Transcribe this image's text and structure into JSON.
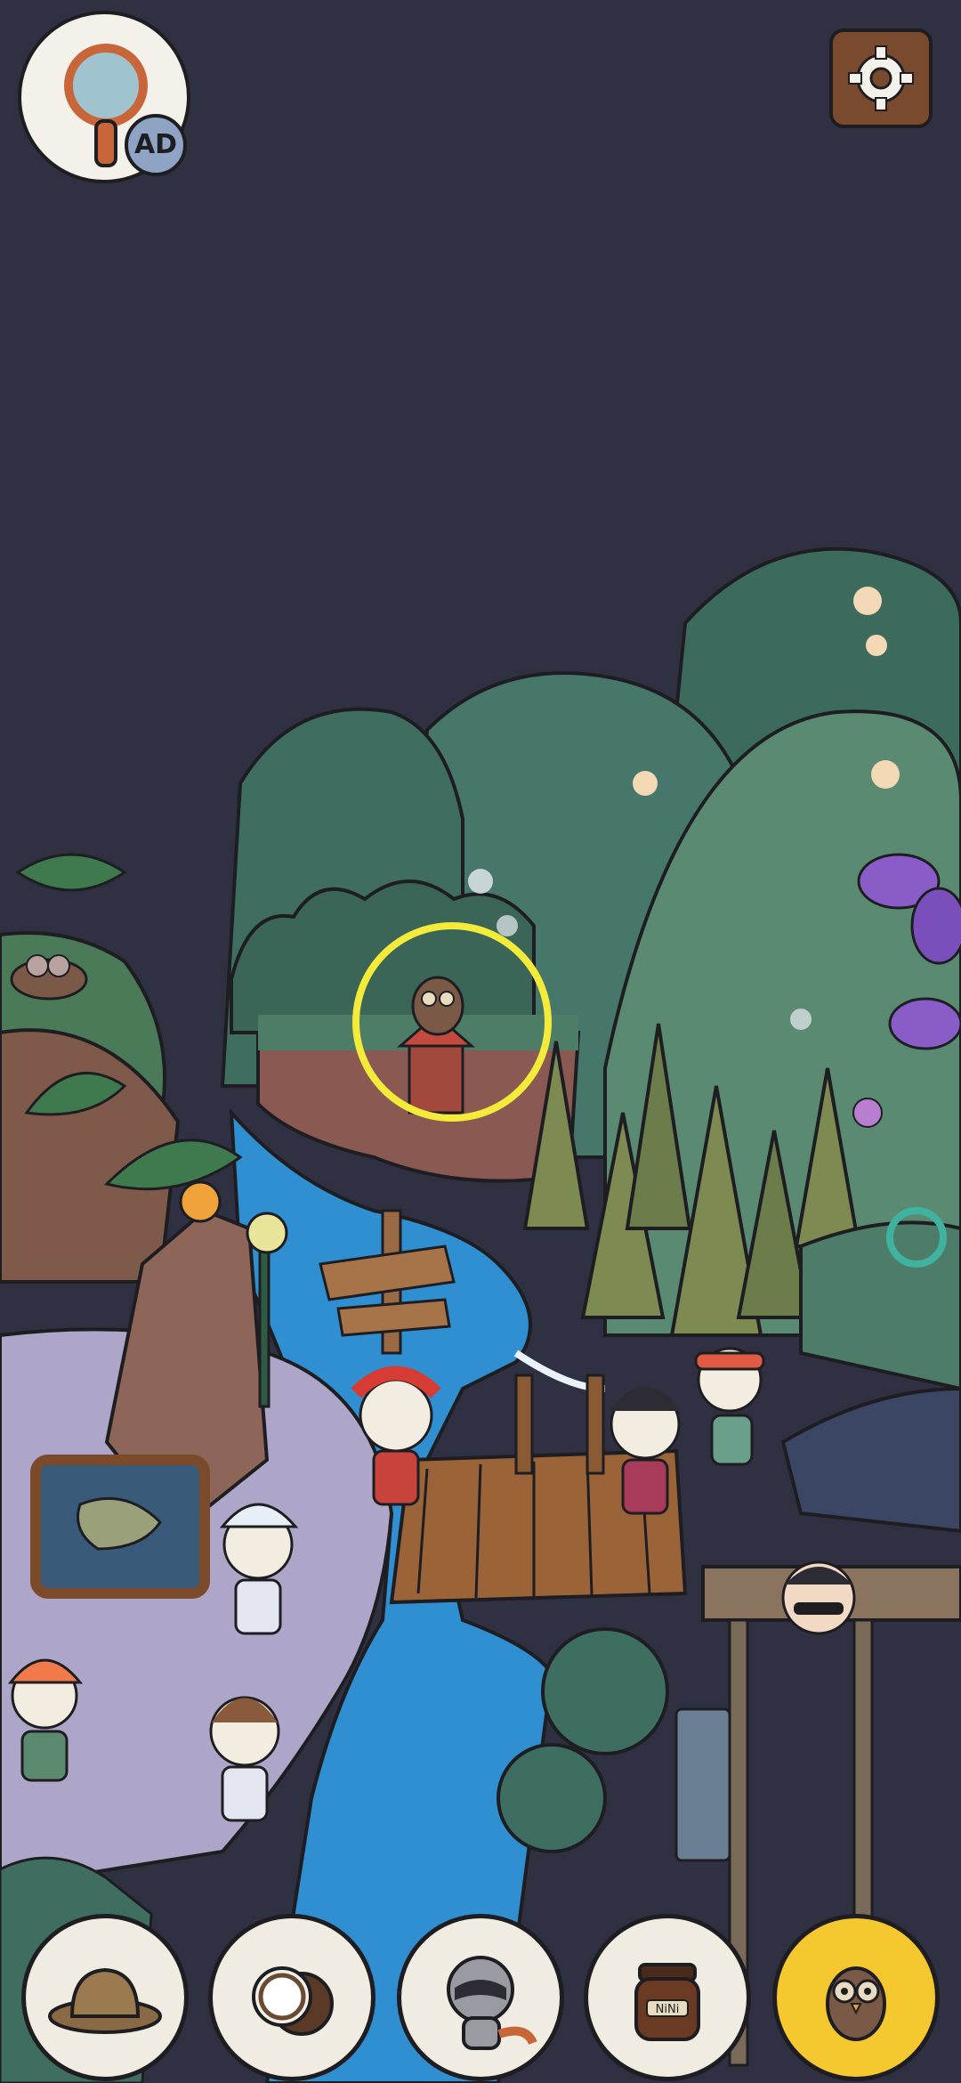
{
  "hud": {
    "hint_button": {
      "icon": "magnifier-icon",
      "badge_label": "AD"
    },
    "settings_button": {
      "icon": "gear-icon"
    }
  },
  "scene": {
    "target_marker_color": "#f3ea3a",
    "crate_label": "NiNi",
    "jar_label": "NiNi"
  },
  "item_tray": [
    {
      "name": "safari-hat",
      "icon": "safari-hat-icon",
      "active": false
    },
    {
      "name": "coconut",
      "icon": "coconut-icon",
      "active": false
    },
    {
      "name": "raccoon",
      "icon": "raccoon-icon",
      "active": false
    },
    {
      "name": "honey-jar",
      "icon": "jar-icon",
      "active": false
    },
    {
      "name": "owl",
      "icon": "owl-icon",
      "active": true
    }
  ],
  "colors": {
    "sky": "#2f3142",
    "river": "#2f8fd0",
    "foliage": "#3f6d5f",
    "active_slot": "#f6c830"
  }
}
